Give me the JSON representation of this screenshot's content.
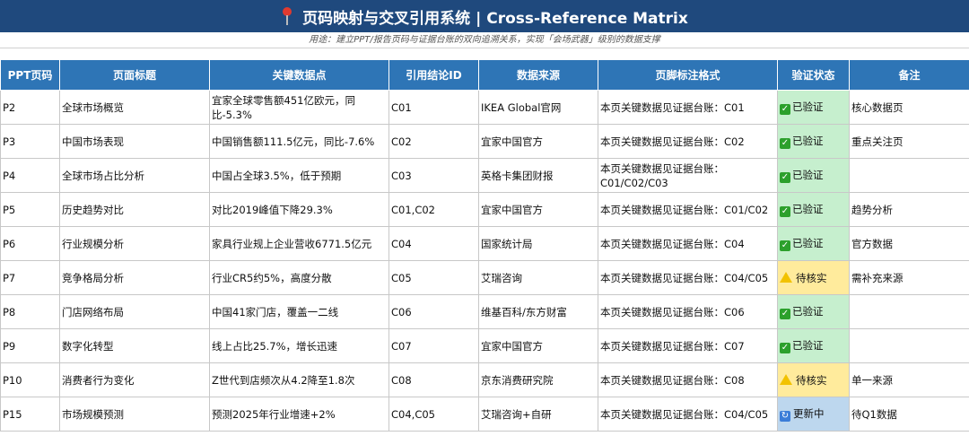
{
  "title": "页码映射与交叉引用系统 | Cross-Reference Matrix",
  "subtitle": "用途：建立PPT/报告页码与证据台账的双向追溯关系，实现「会场武器」级别的数据支撑",
  "icons": {
    "title": "pushpin-icon",
    "verified": "check-icon",
    "pending": "warning-icon",
    "updating": "refresh-icon"
  },
  "colors": {
    "header": "#2e75b6",
    "title_bar": "#1f497d",
    "verified": "#c6efce",
    "pending": "#ffeb9c",
    "updating": "#bdd7ee"
  },
  "columns": [
    "PPT页码",
    "页面标题",
    "关键数据点",
    "引用结论ID",
    "数据来源",
    "页脚标注格式",
    "验证状态",
    "备注"
  ],
  "rows": [
    {
      "page": "P2",
      "title": "全球市场概览",
      "data": "宜家全球零售额451亿欧元，同比-5.3%",
      "ref": "C01",
      "source": "IKEA Global官网",
      "footer": "本页关键数据见证据台账：C01",
      "status": "已验证",
      "status_type": "ok",
      "note": "核心数据页"
    },
    {
      "page": "P3",
      "title": "中国市场表现",
      "data": "中国销售额111.5亿元，同比-7.6%",
      "ref": "C02",
      "source": "宜家中国官方",
      "footer": "本页关键数据见证据台账：C02",
      "status": "已验证",
      "status_type": "ok",
      "note": "重点关注页"
    },
    {
      "page": "P4",
      "title": "全球市场占比分析",
      "data": "中国占全球3.5%，低于预期",
      "ref": "C03",
      "source": "英格卡集团财报",
      "footer": "本页关键数据见证据台账：C01/C02/C03",
      "status": "已验证",
      "status_type": "ok",
      "note": ""
    },
    {
      "page": "P5",
      "title": "历史趋势对比",
      "data": "对比2019峰值下降29.3%",
      "ref": "C01,C02",
      "source": "宜家中国官方",
      "footer": "本页关键数据见证据台账：C01/C02",
      "status": "已验证",
      "status_type": "ok",
      "note": "趋势分析"
    },
    {
      "page": "P6",
      "title": "行业规模分析",
      "data": "家具行业规上企业营收6771.5亿元",
      "ref": "C04",
      "source": "国家统计局",
      "footer": "本页关键数据见证据台账：C04",
      "status": "已验证",
      "status_type": "ok",
      "note": "官方数据"
    },
    {
      "page": "P7",
      "title": "竞争格局分析",
      "data": "行业CR5约5%，高度分散",
      "ref": "C05",
      "source": "艾瑞咨询",
      "footer": "本页关键数据见证据台账：C04/C05",
      "status": "待核实",
      "status_type": "warn",
      "note": "需补充来源"
    },
    {
      "page": "P8",
      "title": "门店网络布局",
      "data": "中国41家门店，覆盖一二线",
      "ref": "C06",
      "source": "维基百科/东方财富",
      "footer": "本页关键数据见证据台账：C06",
      "status": "已验证",
      "status_type": "ok",
      "note": ""
    },
    {
      "page": "P9",
      "title": "数字化转型",
      "data": "线上占比25.7%，增长迅速",
      "ref": "C07",
      "source": "宜家中国官方",
      "footer": "本页关键数据见证据台账：C07",
      "status": "已验证",
      "status_type": "ok",
      "note": ""
    },
    {
      "page": "P10",
      "title": "消费者行为变化",
      "data": "Z世代到店频次从4.2降至1.8次",
      "ref": "C08",
      "source": "京东消费研究院",
      "footer": "本页关键数据见证据台账：C08",
      "status": "待核实",
      "status_type": "warn",
      "note": "单一来源"
    },
    {
      "page": "P15",
      "title": "市场规模预测",
      "data": "预测2025年行业增速+2%",
      "ref": "C04,C05",
      "source": "艾瑞咨询+自研",
      "footer": "本页关键数据见证据台账：C04/C05",
      "status": "更新中",
      "status_type": "upd",
      "note": "待Q1数据"
    }
  ]
}
